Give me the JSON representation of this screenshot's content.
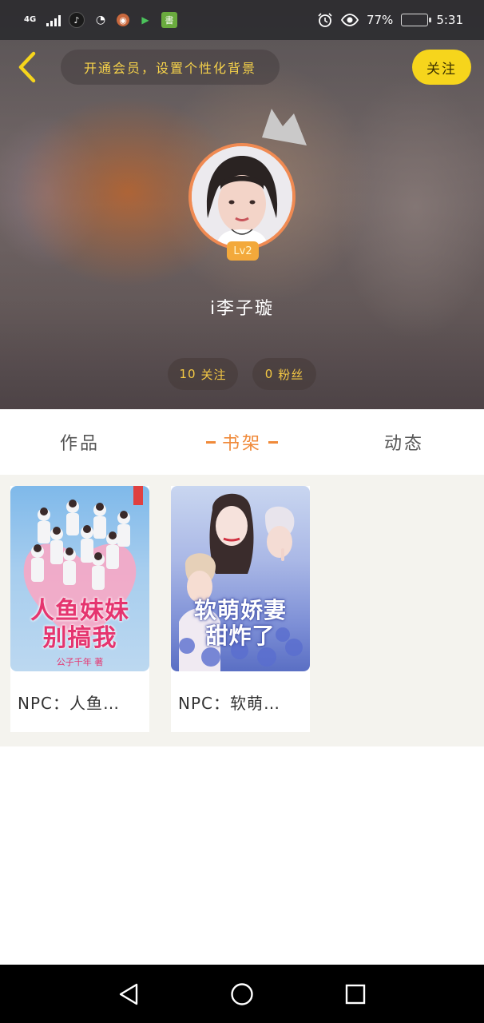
{
  "status_bar": {
    "network": "4G",
    "battery_percent": "77%",
    "battery_level": 0.77,
    "time": "5:31"
  },
  "header": {
    "vip_banner": "开通会员，设置个性化背景",
    "follow_button": "关注"
  },
  "profile": {
    "level": "Lv2",
    "username": "i李子璇",
    "following_count": "10",
    "following_label": "关注",
    "fans_count": "0",
    "fans_label": "粉丝"
  },
  "tabs": [
    {
      "label": "作品",
      "active": false
    },
    {
      "label": "书架",
      "active": true
    },
    {
      "label": "动态",
      "active": false
    }
  ],
  "bookshelf": [
    {
      "title": "NPC：人鱼…",
      "cover_text": "人鱼妹妹\n别搞我",
      "cover_author": "公子千年 著"
    },
    {
      "title": "NPC：软萌…",
      "cover_text": "软萌娇妻\n甜炸了"
    }
  ],
  "colors": {
    "accent": "#f08a3a",
    "follow_button_bg": "#f6d51c",
    "banner_text": "#f7d34a",
    "avatar_ring": "#f08a52"
  }
}
